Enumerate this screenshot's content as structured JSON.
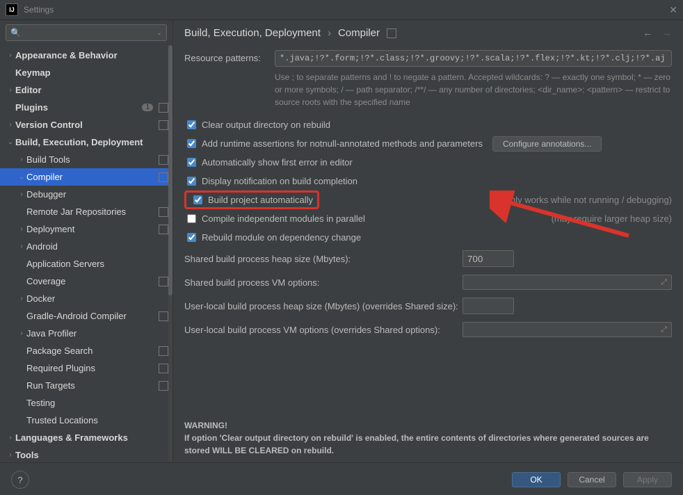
{
  "window": {
    "title": "Settings"
  },
  "search": {
    "placeholder": ""
  },
  "tree": [
    {
      "label": "Appearance & Behavior",
      "level": 0,
      "arrow": "›",
      "bold": true
    },
    {
      "label": "Keymap",
      "level": 0,
      "arrow": "",
      "bold": true
    },
    {
      "label": "Editor",
      "level": 0,
      "arrow": "›",
      "bold": true
    },
    {
      "label": "Plugins",
      "level": 0,
      "arrow": "",
      "bold": true,
      "badge": "1",
      "sq": true
    },
    {
      "label": "Version Control",
      "level": 0,
      "arrow": "›",
      "bold": true,
      "sq": true
    },
    {
      "label": "Build, Execution, Deployment",
      "level": 0,
      "arrow": "⌄",
      "bold": true
    },
    {
      "label": "Build Tools",
      "level": 1,
      "arrow": "›",
      "sq": true
    },
    {
      "label": "Compiler",
      "level": 1,
      "arrow": "⌄",
      "selected": true,
      "sq": true
    },
    {
      "label": "Debugger",
      "level": 1,
      "arrow": "›"
    },
    {
      "label": "Remote Jar Repositories",
      "level": 1,
      "arrow": "",
      "sq": true
    },
    {
      "label": "Deployment",
      "level": 1,
      "arrow": "›",
      "sq": true
    },
    {
      "label": "Android",
      "level": 1,
      "arrow": "›"
    },
    {
      "label": "Application Servers",
      "level": 1,
      "arrow": ""
    },
    {
      "label": "Coverage",
      "level": 1,
      "arrow": "",
      "sq": true
    },
    {
      "label": "Docker",
      "level": 1,
      "arrow": "›"
    },
    {
      "label": "Gradle-Android Compiler",
      "level": 1,
      "arrow": "",
      "sq": true
    },
    {
      "label": "Java Profiler",
      "level": 1,
      "arrow": "›"
    },
    {
      "label": "Package Search",
      "level": 1,
      "arrow": "",
      "sq": true
    },
    {
      "label": "Required Plugins",
      "level": 1,
      "arrow": "",
      "sq": true
    },
    {
      "label": "Run Targets",
      "level": 1,
      "arrow": "",
      "sq": true
    },
    {
      "label": "Testing",
      "level": 1,
      "arrow": ""
    },
    {
      "label": "Trusted Locations",
      "level": 1,
      "arrow": ""
    },
    {
      "label": "Languages & Frameworks",
      "level": 0,
      "arrow": "›",
      "bold": true
    },
    {
      "label": "Tools",
      "level": 0,
      "arrow": "›",
      "bold": true
    }
  ],
  "breadcrumb": {
    "a": "Build, Execution, Deployment",
    "sep": "›",
    "b": "Compiler"
  },
  "resource": {
    "label": "Resource patterns:",
    "value": "*.java;!?*.form;!?*.class;!?*.groovy;!?*.scala;!?*.flex;!?*.kt;!?*.clj;!?*.aj",
    "help": "Use ; to separate patterns and ! to negate a pattern. Accepted wildcards: ? — exactly one symbol; * — zero or more symbols; / — path separator; /**/ — any number of directories; <dir_name>: <pattern> — restrict to source roots with the specified name"
  },
  "checks": {
    "clear": "Clear output directory on rebuild",
    "runtime": "Add runtime assertions for notnull-annotated methods and parameters",
    "configure": "Configure annotations...",
    "autoerr": "Automatically show first error in editor",
    "notify": "Display notification on build completion",
    "auto": "Build project automatically",
    "auto_side": "(only works while not running / debugging)",
    "parallel": "Compile independent modules in parallel",
    "parallel_side": "(may require larger heap size)",
    "rebuild": "Rebuild module on dependency change"
  },
  "fields": {
    "heap": {
      "label": "Shared build process heap size (Mbytes):",
      "value": "700"
    },
    "vm": {
      "label": "Shared build process VM options:"
    },
    "uheap": {
      "label": "User-local build process heap size (Mbytes) (overrides Shared size):"
    },
    "uvm": {
      "label": "User-local build process VM options (overrides Shared options):"
    }
  },
  "warning": {
    "title": "WARNING!",
    "body": "If option 'Clear output directory on rebuild' is enabled, the entire contents of directories where generated sources are stored WILL BE CLEARED on rebuild."
  },
  "footer": {
    "ok": "OK",
    "cancel": "Cancel",
    "apply": "Apply"
  }
}
